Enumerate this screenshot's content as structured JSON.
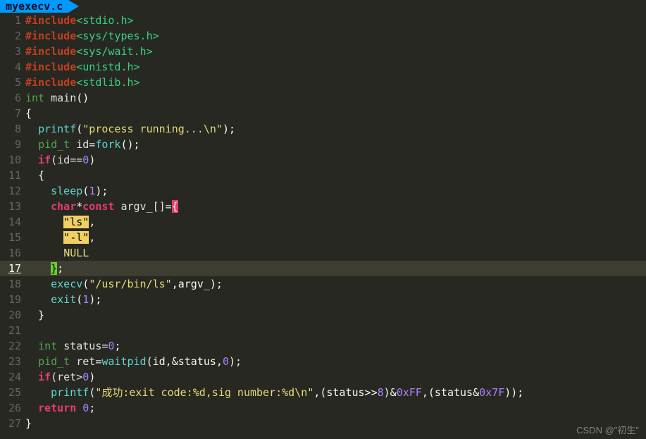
{
  "tab": {
    "filename": "myexecv.c"
  },
  "watermark": "CSDN @\"初生\"",
  "current_line": 17,
  "lines": [
    {
      "n": 1,
      "tokens": [
        {
          "t": "#include",
          "c": "c-pre"
        },
        {
          "t": "<stdio.h>",
          "c": "c-inc"
        }
      ]
    },
    {
      "n": 2,
      "tokens": [
        {
          "t": "#include",
          "c": "c-pre"
        },
        {
          "t": "<sys/types.h>",
          "c": "c-inc"
        }
      ]
    },
    {
      "n": 3,
      "tokens": [
        {
          "t": "#include",
          "c": "c-pre"
        },
        {
          "t": "<sys/wait.h>",
          "c": "c-inc"
        }
      ]
    },
    {
      "n": 4,
      "tokens": [
        {
          "t": "#include",
          "c": "c-pre"
        },
        {
          "t": "<unistd.h>",
          "c": "c-inc"
        }
      ]
    },
    {
      "n": 5,
      "tokens": [
        {
          "t": "#include",
          "c": "c-pre"
        },
        {
          "t": "<stdlib.h>",
          "c": "c-inc"
        }
      ]
    },
    {
      "n": 6,
      "tokens": [
        {
          "t": "int ",
          "c": "c-type"
        },
        {
          "t": "main",
          "c": "c-ident"
        },
        {
          "t": "()",
          "c": "c-punct"
        }
      ]
    },
    {
      "n": 7,
      "tokens": [
        {
          "t": "{",
          "c": "c-punct"
        }
      ]
    },
    {
      "n": 8,
      "tokens": [
        {
          "t": "  ",
          "c": "c-punct"
        },
        {
          "t": "printf",
          "c": "c-func"
        },
        {
          "t": "(",
          "c": "c-punct"
        },
        {
          "t": "\"process running...\\n\"",
          "c": "c-str"
        },
        {
          "t": ");",
          "c": "c-punct"
        }
      ]
    },
    {
      "n": 9,
      "tokens": [
        {
          "t": "  ",
          "c": "c-punct"
        },
        {
          "t": "pid_t ",
          "c": "c-type"
        },
        {
          "t": "id=",
          "c": "c-ident"
        },
        {
          "t": "fork",
          "c": "c-func"
        },
        {
          "t": "();",
          "c": "c-punct"
        }
      ]
    },
    {
      "n": 10,
      "tokens": [
        {
          "t": "  ",
          "c": "c-punct"
        },
        {
          "t": "if",
          "c": "c-keyw"
        },
        {
          "t": "(id==",
          "c": "c-ident"
        },
        {
          "t": "0",
          "c": "c-num"
        },
        {
          "t": ")",
          "c": "c-punct"
        }
      ]
    },
    {
      "n": 11,
      "tokens": [
        {
          "t": "  {",
          "c": "c-punct"
        }
      ]
    },
    {
      "n": 12,
      "tokens": [
        {
          "t": "    ",
          "c": "c-punct"
        },
        {
          "t": "sleep",
          "c": "c-func"
        },
        {
          "t": "(",
          "c": "c-punct"
        },
        {
          "t": "1",
          "c": "c-num"
        },
        {
          "t": ");",
          "c": "c-punct"
        }
      ]
    },
    {
      "n": 13,
      "tokens": [
        {
          "t": "    ",
          "c": "c-punct"
        },
        {
          "t": "char",
          "c": "c-keyw"
        },
        {
          "t": "*",
          "c": "c-punct"
        },
        {
          "t": "const ",
          "c": "c-keyw"
        },
        {
          "t": "argv_[]=",
          "c": "c-ident"
        },
        {
          "t": "{",
          "c": "brace-open"
        }
      ]
    },
    {
      "n": 14,
      "tokens": [
        {
          "t": "      ",
          "c": "c-punct"
        },
        {
          "t": "\"ls\"",
          "c": "bg-yellow"
        },
        {
          "t": ",",
          "c": "c-punct"
        }
      ]
    },
    {
      "n": 15,
      "tokens": [
        {
          "t": "      ",
          "c": "c-punct"
        },
        {
          "t": "\"-l\"",
          "c": "bg-yellow"
        },
        {
          "t": ",",
          "c": "c-punct"
        }
      ]
    },
    {
      "n": 16,
      "tokens": [
        {
          "t": "      ",
          "c": "c-punct"
        },
        {
          "t": "NULL",
          "c": "c-str"
        }
      ]
    },
    {
      "n": 17,
      "tokens": [
        {
          "t": "    ",
          "c": "c-punct"
        },
        {
          "t": "}",
          "c": "brace-close"
        },
        {
          "t": ";",
          "c": "c-punct"
        }
      ]
    },
    {
      "n": 18,
      "tokens": [
        {
          "t": "    ",
          "c": "c-punct"
        },
        {
          "t": "execv",
          "c": "c-func"
        },
        {
          "t": "(",
          "c": "c-punct"
        },
        {
          "t": "\"/usr/bin/ls\"",
          "c": "c-str"
        },
        {
          "t": ",argv_);",
          "c": "c-punct"
        }
      ]
    },
    {
      "n": 19,
      "tokens": [
        {
          "t": "    ",
          "c": "c-punct"
        },
        {
          "t": "exit",
          "c": "c-func"
        },
        {
          "t": "(",
          "c": "c-punct"
        },
        {
          "t": "1",
          "c": "c-num"
        },
        {
          "t": ");",
          "c": "c-punct"
        }
      ]
    },
    {
      "n": 20,
      "tokens": [
        {
          "t": "  }",
          "c": "c-punct"
        }
      ]
    },
    {
      "n": 21,
      "tokens": [
        {
          "t": "",
          "c": "c-punct"
        }
      ]
    },
    {
      "n": 22,
      "tokens": [
        {
          "t": "  ",
          "c": "c-punct"
        },
        {
          "t": "int ",
          "c": "c-type"
        },
        {
          "t": "status=",
          "c": "c-ident"
        },
        {
          "t": "0",
          "c": "c-num"
        },
        {
          "t": ";",
          "c": "c-punct"
        }
      ]
    },
    {
      "n": 23,
      "tokens": [
        {
          "t": "  ",
          "c": "c-punct"
        },
        {
          "t": "pid_t ",
          "c": "c-type"
        },
        {
          "t": "ret=",
          "c": "c-ident"
        },
        {
          "t": "waitpid",
          "c": "c-func"
        },
        {
          "t": "(id,&status,",
          "c": "c-punct"
        },
        {
          "t": "0",
          "c": "c-num"
        },
        {
          "t": ");",
          "c": "c-punct"
        }
      ]
    },
    {
      "n": 24,
      "tokens": [
        {
          "t": "  ",
          "c": "c-punct"
        },
        {
          "t": "if",
          "c": "c-keyw"
        },
        {
          "t": "(ret>",
          "c": "c-ident"
        },
        {
          "t": "0",
          "c": "c-num"
        },
        {
          "t": ")",
          "c": "c-punct"
        }
      ]
    },
    {
      "n": 25,
      "tokens": [
        {
          "t": "    ",
          "c": "c-punct"
        },
        {
          "t": "printf",
          "c": "c-func"
        },
        {
          "t": "(",
          "c": "c-punct"
        },
        {
          "t": "\"成功:exit code:%d,sig number:%d\\n\"",
          "c": "c-str"
        },
        {
          "t": ",(status>>",
          "c": "c-punct"
        },
        {
          "t": "8",
          "c": "c-num"
        },
        {
          "t": ")&",
          "c": "c-punct"
        },
        {
          "t": "0xFF",
          "c": "c-num"
        },
        {
          "t": ",(status&",
          "c": "c-punct"
        },
        {
          "t": "0x7F",
          "c": "c-num"
        },
        {
          "t": "));",
          "c": "c-punct"
        }
      ]
    },
    {
      "n": 26,
      "tokens": [
        {
          "t": "  ",
          "c": "c-punct"
        },
        {
          "t": "return ",
          "c": "c-keyw"
        },
        {
          "t": "0",
          "c": "c-num"
        },
        {
          "t": ";",
          "c": "c-punct"
        }
      ]
    },
    {
      "n": 27,
      "tokens": [
        {
          "t": "}",
          "c": "c-punct"
        }
      ]
    }
  ]
}
